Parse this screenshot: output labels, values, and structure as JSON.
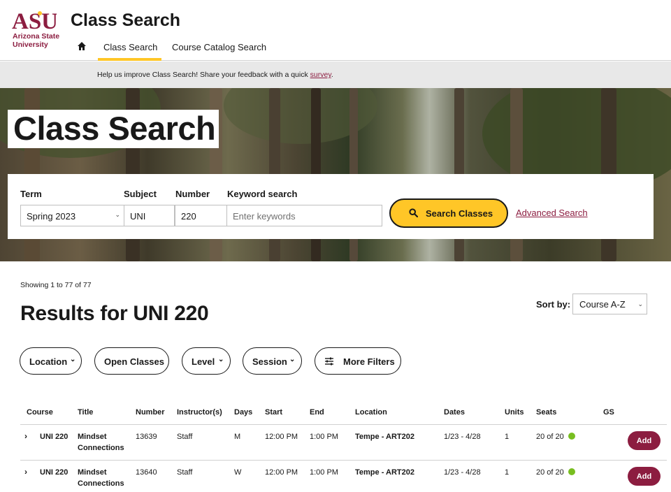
{
  "header": {
    "logo_word": "ASU",
    "logo_line1": "Arizona State",
    "logo_line2": "University",
    "site_title": "Class Search",
    "nav": {
      "class_search": "Class Search",
      "catalog_search": "Course Catalog Search"
    }
  },
  "banner": {
    "text": "Help us improve Class Search! Share your feedback with a quick ",
    "link": "survey",
    "end": "."
  },
  "hero": {
    "title": "Class Search"
  },
  "search": {
    "term_label": "Term",
    "term_value": "Spring 2023",
    "subject_label": "Subject",
    "subject_value": "UNI",
    "number_label": "Number",
    "number_value": "220",
    "keyword_label": "Keyword search",
    "keyword_placeholder": "Enter keywords",
    "button": "Search Classes",
    "advanced": "Advanced Search"
  },
  "results": {
    "showing": "Showing 1 to 77 of 77",
    "title": "Results for UNI 220",
    "sort_label": "Sort by:",
    "sort_value": "Course A-Z"
  },
  "filters": [
    "Location",
    "Open Classes",
    "Level",
    "Session",
    "More Filters"
  ],
  "table": {
    "headers": {
      "course": "Course",
      "title": "Title",
      "number": "Number",
      "instructor": "Instructor(s)",
      "days": "Days",
      "start": "Start",
      "end": "End",
      "location": "Location",
      "dates": "Dates",
      "units": "Units",
      "seats": "Seats",
      "gs": "GS"
    },
    "rows": [
      {
        "course": "UNI 220",
        "title1": "Mindset",
        "title2": "Connections",
        "number": "13639",
        "instructor": "Staff",
        "days": "M",
        "start": "12:00 PM",
        "end": "1:00 PM",
        "location": "Tempe - ART202",
        "dates": "1/23 - 4/28",
        "units": "1",
        "seats": "20 of 20",
        "action": "Add"
      },
      {
        "course": "UNI 220",
        "title1": "Mindset",
        "title2": "Connections",
        "number": "13640",
        "instructor": "Staff",
        "days": "W",
        "start": "12:00 PM",
        "end": "1:00 PM",
        "location": "Tempe - ART202",
        "dates": "1/23 - 4/28",
        "units": "1",
        "seats": "20 of 20",
        "action": "Add"
      }
    ]
  },
  "colors": {
    "maroon": "#8c1d40",
    "gold": "#ffc627",
    "open_seat": "#78be20"
  }
}
